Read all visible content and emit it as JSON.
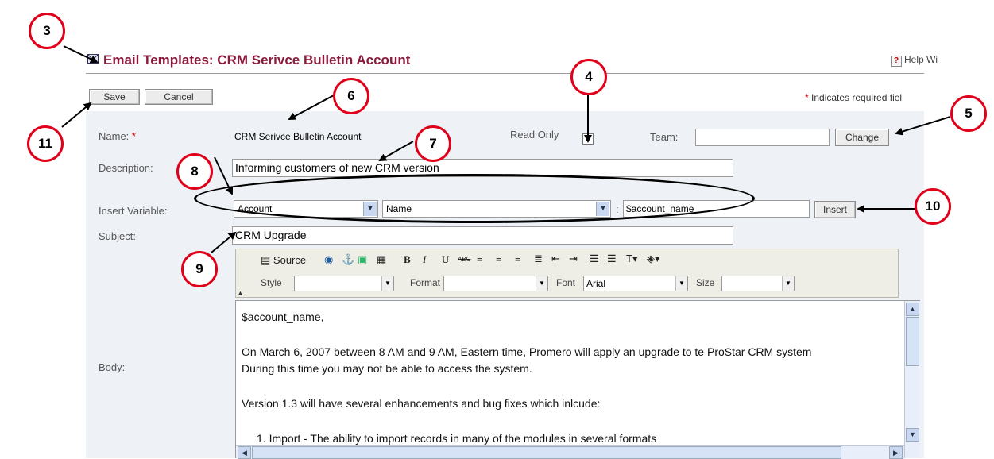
{
  "header": {
    "title": "Email Templates: CRM Serivce Bulletin Account",
    "help_label": "Help Wi"
  },
  "toolbar": {
    "save_label": "Save",
    "cancel_label": "Cancel",
    "required_star": "*",
    "required_note": "Indicates required fiel"
  },
  "form": {
    "name_label": "Name:",
    "name_required": "*",
    "name_value": "CRM Serivce Bulletin Account",
    "read_only_label": "Read Only",
    "read_only_checked": "✓",
    "team_label": "Team:",
    "team_value": "",
    "change_label": "Change",
    "description_label": "Description:",
    "description_value": "Informing customers of new CRM version",
    "insert_variable_label": "Insert Variable:",
    "variable_module": "Account",
    "variable_field": "Name",
    "variable_separator": ":",
    "variable_value": "$account_name",
    "insert_label": "Insert",
    "subject_label": "Subject:",
    "subject_value": "CRM Upgrade",
    "body_label": "Body:"
  },
  "editor": {
    "source_label": "Source",
    "bold": "B",
    "italic": "I",
    "underline": "U",
    "strike": "ABC",
    "style_label": "Style",
    "style_value": "",
    "format_label": "Format",
    "format_value": "",
    "font_label": "Font",
    "font_value": "Arial",
    "size_label": "Size",
    "size_value": "",
    "body_lines": [
      "$account_name,",
      "On March 6, 2007 between 8 AM and 9 AM, Eastern time, Promero will apply an upgrade to te ProStar CRM system",
      "During this time you may not be able to access the system.",
      "Version 1.3 will have several enhancements and bug fixes which inlcude:",
      "1.    Import - The ability to import records in many of the modules in several formats"
    ]
  },
  "annotations": [
    "3",
    "4",
    "5",
    "6",
    "7",
    "8",
    "9",
    "10",
    "11"
  ],
  "colors": {
    "title": "#8b1a3b",
    "callout_border": "#e0001a",
    "panel_bg": "#eef2f7"
  }
}
